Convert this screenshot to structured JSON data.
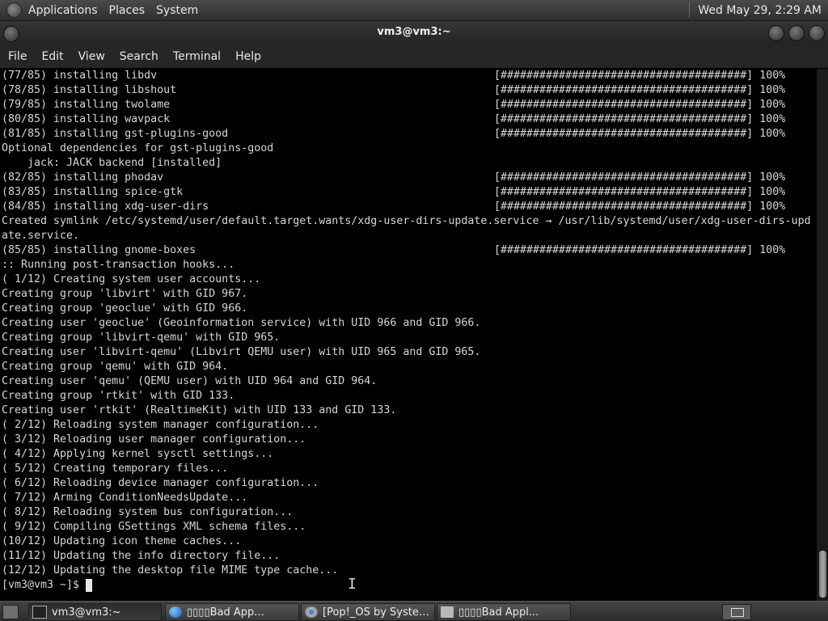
{
  "top_panel": {
    "menus": [
      "Applications",
      "Places",
      "System"
    ],
    "clock": "Wed May 29,  2:29 AM"
  },
  "window": {
    "title": "vm3@vm3:~"
  },
  "menubar": [
    "File",
    "Edit",
    "View",
    "Search",
    "Terminal",
    "Help"
  ],
  "terminal": {
    "lines": [
      "(77/85) installing libdv",
      "(78/85) installing libshout",
      "(79/85) installing twolame",
      "(80/85) installing wavpack",
      "(81/85) installing gst-plugins-good",
      "Optional dependencies for gst-plugins-good",
      "    jack: JACK backend [installed]",
      "(82/85) installing phodav",
      "(83/85) installing spice-gtk",
      "(84/85) installing xdg-user-dirs",
      "Created symlink /etc/systemd/user/default.target.wants/xdg-user-dirs-update.service → /usr/lib/systemd/user/xdg-user-dirs-upd",
      "ate.service.",
      "(85/85) installing gnome-boxes",
      ":: Running post-transaction hooks...",
      "( 1/12) Creating system user accounts...",
      "Creating group 'libvirt' with GID 967.",
      "Creating group 'geoclue' with GID 966.",
      "Creating user 'geoclue' (Geoinformation service) with UID 966 and GID 966.",
      "Creating group 'libvirt-qemu' with GID 965.",
      "Creating user 'libvirt-qemu' (Libvirt QEMU user) with UID 965 and GID 965.",
      "Creating group 'qemu' with GID 964.",
      "Creating user 'qemu' (QEMU user) with UID 964 and GID 964.",
      "Creating group 'rtkit' with GID 133.",
      "Creating user 'rtkit' (RealtimeKit) with UID 133 and GID 133.",
      "( 2/12) Reloading system manager configuration...",
      "( 3/12) Reloading user manager configuration...",
      "( 4/12) Applying kernel sysctl settings...",
      "( 5/12) Creating temporary files...",
      "( 6/12) Reloading device manager configuration...",
      "( 7/12) Arming ConditionNeedsUpdate...",
      "( 8/12) Reloading system bus configuration...",
      "( 9/12) Compiling GSettings XML schema files...",
      "(10/12) Updating icon theme caches...",
      "(11/12) Updating the info directory file...",
      "(12/12) Updating the desktop file MIME type cache...",
      "[vm3@vm3 ~]$ "
    ],
    "progress": [
      "[######################################] 100%",
      "[######################################] 100%",
      "[######################################] 100%",
      "[######################################] 100%",
      "[######################################] 100%",
      "",
      "",
      "[######################################] 100%",
      "[######################################] 100%",
      "[######################################] 100%",
      "",
      "",
      "[######################################] 100%"
    ]
  },
  "taskbar": {
    "tasks": [
      {
        "label": "vm3@vm3:~",
        "icon": "terminal-icon"
      },
      {
        "label": "▯▯▯▯Bad App...",
        "icon": "web-browser-icon"
      },
      {
        "label": "[Pop!_OS by System...",
        "icon": "chromium-icon"
      },
      {
        "label": "▯▯▯▯Bad Appl...",
        "icon": "folder-icon"
      }
    ]
  }
}
